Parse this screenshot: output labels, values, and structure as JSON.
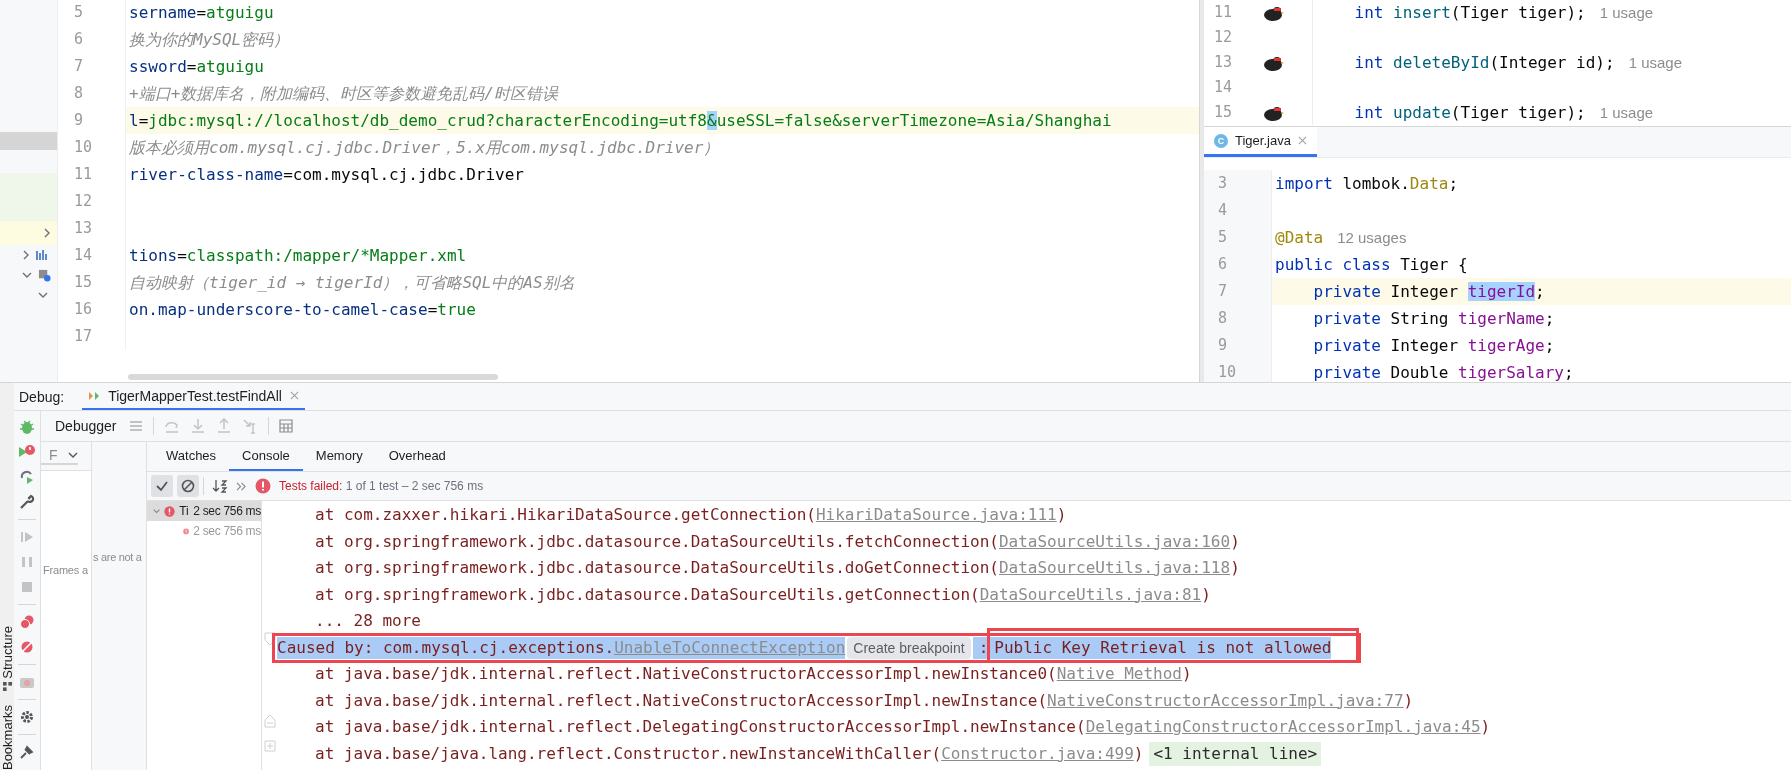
{
  "editor_left": {
    "lines": [
      {
        "number": "5",
        "current": false,
        "tokens": [
          {
            "text": "sername",
            "kind": "key"
          },
          {
            "text": "=",
            "kind": "plain"
          },
          {
            "text": "atguigu",
            "kind": "value"
          }
        ]
      },
      {
        "number": "6",
        "current": false,
        "tokens": [
          {
            "text": "换为你的MySQL密码）",
            "kind": "comment"
          }
        ]
      },
      {
        "number": "7",
        "current": false,
        "tokens": [
          {
            "text": "ssword",
            "kind": "key"
          },
          {
            "text": "=",
            "kind": "plain"
          },
          {
            "text": "atguigu",
            "kind": "value"
          }
        ]
      },
      {
        "number": "8",
        "current": false,
        "tokens": [
          {
            "text": "+端口+数据库名，附加编码、时区等参数避免乱码/时区错误",
            "kind": "comment"
          }
        ]
      },
      {
        "number": "9",
        "current": true,
        "tokens": [
          {
            "text": "l",
            "kind": "key"
          },
          {
            "text": "=",
            "kind": "plain"
          },
          {
            "text": "jdbc:mysql://localhost/db_demo_crud?characterEncoding=utf8",
            "kind": "value"
          },
          {
            "text": "&",
            "kind": "caret"
          },
          {
            "text": "useSSL=false&serverTimezone=Asia/Shanghai",
            "kind": "value"
          }
        ]
      },
      {
        "number": "10",
        "current": false,
        "tokens": [
          {
            "text": "版本必须用com.mysql.cj.jdbc.Driver，5.x用com.mysql.jdbc.Driver）",
            "kind": "comment"
          }
        ]
      },
      {
        "number": "11",
        "current": false,
        "tokens": [
          {
            "text": "river-class-name",
            "kind": "key"
          },
          {
            "text": "=com.mysql.cj.jdbc.Driver",
            "kind": "plain"
          }
        ]
      },
      {
        "number": "12",
        "current": false
      },
      {
        "number": "13",
        "current": false
      },
      {
        "number": "14",
        "current": false,
        "tokens": [
          {
            "text": "tions",
            "kind": "key"
          },
          {
            "text": "=",
            "kind": "plain"
          },
          {
            "text": "classpath:/mapper/*Mapper.xml",
            "kind": "value"
          }
        ]
      },
      {
        "number": "15",
        "current": false,
        "tokens": [
          {
            "text": "自动映射（tiger_id → tigerId），可省略SQL中的AS别名",
            "kind": "comment"
          }
        ]
      },
      {
        "number": "16",
        "current": false,
        "tokens": [
          {
            "text": "on.map-underscore-to-camel-case",
            "kind": "key"
          },
          {
            "text": "=",
            "kind": "plain"
          },
          {
            "text": "true",
            "kind": "value"
          }
        ]
      },
      {
        "number": "17",
        "current": false
      }
    ]
  },
  "editor_mapper": {
    "lines": [
      {
        "number": "11",
        "marker": true,
        "tokens": [
          {
            "text": "    int ",
            "kind": "kw"
          },
          {
            "text": "insert",
            "kind": "method"
          },
          {
            "text": "(Tiger tiger);",
            "kind": "plain"
          },
          {
            "text": "1 usage",
            "kind": "hint"
          }
        ]
      },
      {
        "number": "12",
        "marker": false
      },
      {
        "number": "13",
        "marker": true,
        "tokens": [
          {
            "text": "    int ",
            "kind": "kw"
          },
          {
            "text": "deleteById",
            "kind": "method"
          },
          {
            "text": "(Integer id);",
            "kind": "plain"
          },
          {
            "text": "1 usage",
            "kind": "hint"
          }
        ]
      },
      {
        "number": "14",
        "marker": false
      },
      {
        "number": "15",
        "marker": true,
        "tokens": [
          {
            "text": "    int ",
            "kind": "kw"
          },
          {
            "text": "update",
            "kind": "method"
          },
          {
            "text": "(Tiger tiger);",
            "kind": "plain"
          },
          {
            "text": "1 usage",
            "kind": "hint"
          }
        ]
      }
    ]
  },
  "editor_tiger": {
    "tab": {
      "icon_letter": "C",
      "label": "Tiger.java",
      "selected": true
    },
    "lines": [
      {
        "number": "3",
        "current": false,
        "tokens": [
          {
            "text": "import",
            "kind": "kw"
          },
          {
            "text": " lombok.",
            "kind": "plain"
          },
          {
            "text": "Data",
            "kind": "annotation"
          },
          {
            "text": ";",
            "kind": "plain"
          }
        ]
      },
      {
        "number": "4",
        "current": false
      },
      {
        "number": "5",
        "current": false,
        "tokens": [
          {
            "text": "@Data",
            "kind": "annotation"
          },
          {
            "text": "12 usages",
            "kind": "hint"
          }
        ]
      },
      {
        "number": "6",
        "current": false,
        "tokens": [
          {
            "text": "public class",
            "kind": "kw"
          },
          {
            "text": " Tiger {",
            "kind": "plain"
          }
        ]
      },
      {
        "number": "7",
        "current": true,
        "tokens": [
          {
            "text": "    private",
            "kind": "kw"
          },
          {
            "text": " Integer ",
            "kind": "plain"
          },
          {
            "text": "tigerId",
            "kind": "selected"
          },
          {
            "text": ";",
            "kind": "plain"
          }
        ]
      },
      {
        "number": "8",
        "current": false,
        "tokens": [
          {
            "text": "    private",
            "kind": "kw"
          },
          {
            "text": " String ",
            "kind": "plain"
          },
          {
            "text": "tigerName",
            "kind": "field"
          },
          {
            "text": ";",
            "kind": "plain"
          }
        ]
      },
      {
        "number": "9",
        "current": false,
        "tokens": [
          {
            "text": "    private",
            "kind": "kw"
          },
          {
            "text": " Integer ",
            "kind": "plain"
          },
          {
            "text": "tigerAge",
            "kind": "field"
          },
          {
            "text": ";",
            "kind": "plain"
          }
        ]
      },
      {
        "number": "10",
        "current": false,
        "tokens": [
          {
            "text": "    private",
            "kind": "kw"
          },
          {
            "text": " Double ",
            "kind": "plain"
          },
          {
            "text": "tigerSalary",
            "kind": "field"
          },
          {
            "text": ";",
            "kind": "plain"
          }
        ]
      }
    ]
  },
  "side_labels": [
    "Structure",
    "Bookmarks"
  ],
  "debug": {
    "label": "Debug:",
    "session_tab": {
      "label": "TigerMapperTest.testFindAll",
      "selected": true
    },
    "toolbar_label": "Debugger",
    "frames": {
      "dropdown": "F",
      "message_left": "Frames a",
      "message_right": "s are not a"
    },
    "tabs": [
      {
        "label": "Watches",
        "selected": false
      },
      {
        "label": "Console",
        "selected": true
      },
      {
        "label": "Memory",
        "selected": false
      },
      {
        "label": "Overhead",
        "selected": false
      }
    ],
    "test_status": {
      "label": "Tests failed:",
      "detail": "1 of 1 test – 2 sec 756 ms"
    },
    "test_tree": [
      {
        "name": "Ti",
        "time": "2 sec 756 ms",
        "expanded": true,
        "selected": true
      },
      {
        "time": "2 sec 756 ms",
        "selected": false
      }
    ],
    "console": [
      {
        "kind": "frame",
        "text": "at com.zaxxer.hikari.HikariDataSource.getConnection(",
        "link": "HikariDataSource.java:111",
        "after": ")"
      },
      {
        "kind": "frame",
        "text": "at org.springframework.jdbc.datasource.DataSourceUtils.fetchConnection(",
        "link": "DataSourceUtils.java:160",
        "after": ")"
      },
      {
        "kind": "frame",
        "text": "at org.springframework.jdbc.datasource.DataSourceUtils.doGetConnection(",
        "link": "DataSourceUtils.java:118",
        "after": ")"
      },
      {
        "kind": "frame",
        "text": "at org.springframework.jdbc.datasource.DataSourceUtils.getConnection(",
        "link": "DataSourceUtils.java:81",
        "after": ")"
      },
      {
        "kind": "more",
        "text": "... 28 more"
      },
      {
        "kind": "caused",
        "text": "Caused by: com.mysql.cj.exceptions.",
        "link": "UnableToConnectException",
        "button": "Create breakpoint",
        "separator": ":",
        "message": "Public Key Retrieval is not allowed"
      },
      {
        "kind": "frame",
        "text": "at java.base/jdk.internal.reflect.NativeConstructorAccessorImpl.newInstance0(",
        "link": "Native Method",
        "after": ")"
      },
      {
        "kind": "frame",
        "text": "at java.base/jdk.internal.reflect.NativeConstructorAccessorImpl.newInstance(",
        "link": "NativeConstructorAccessorImpl.java:77",
        "after": ")"
      },
      {
        "kind": "frame",
        "text": "at java.base/jdk.internal.reflect.DelegatingConstructorAccessorImpl.newInstance(",
        "link": "DelegatingConstructorAccessorImpl.java:45",
        "after": ")"
      },
      {
        "kind": "frame",
        "text": "at java.base/java.lang.reflect.Constructor.newInstanceWithCaller(",
        "link": "Constructor.java:499",
        "after": ")",
        "badge": "<1 internal line>"
      }
    ]
  }
}
